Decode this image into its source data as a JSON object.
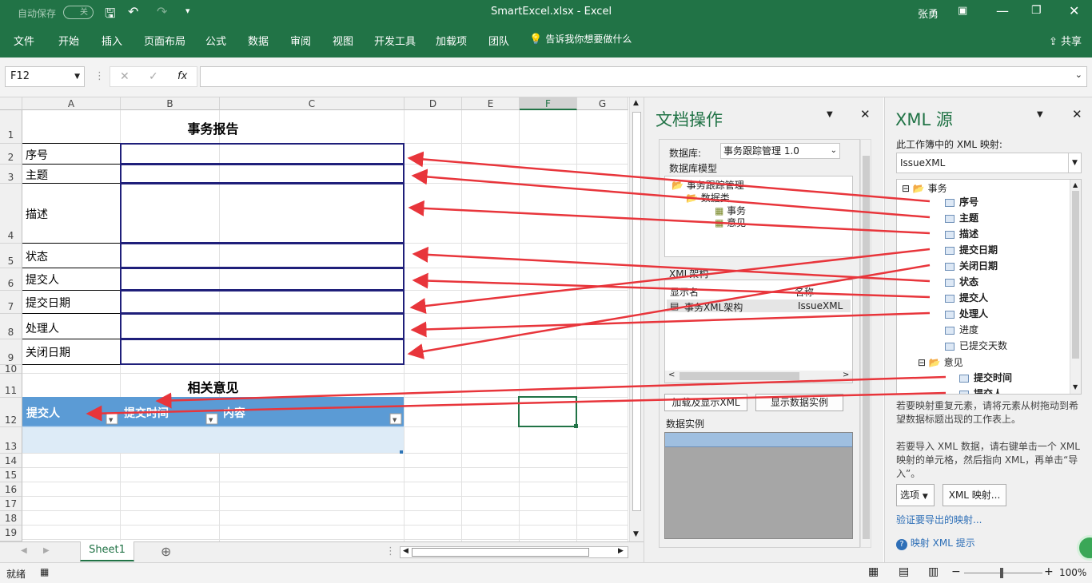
{
  "titlebar": {
    "autosave_label": "自动保存",
    "autosave_state": "关",
    "filename": "SmartExcel.xlsx  -  Excel",
    "user": "张勇"
  },
  "ribbon": {
    "tabs": [
      "文件",
      "开始",
      "插入",
      "页面布局",
      "公式",
      "数据",
      "审阅",
      "视图",
      "开发工具",
      "加载项",
      "团队"
    ],
    "tell_me": "告诉我你想要做什么",
    "share": "共享"
  },
  "formula_bar": {
    "name_box": "F12",
    "fx": "fx",
    "formula": ""
  },
  "sheet": {
    "columns": [
      "A",
      "B",
      "C",
      "D",
      "E",
      "F",
      "G"
    ],
    "rows": [
      "1",
      "2",
      "3",
      "4",
      "5",
      "6",
      "7",
      "8",
      "9",
      "10",
      "11",
      "12",
      "13",
      "14",
      "15",
      "16",
      "17",
      "18",
      "19"
    ],
    "report_title": "事务报告",
    "labels": [
      "序号",
      "主题",
      "描述",
      "状态",
      "提交人",
      "提交日期",
      "处理人",
      "关闭日期"
    ],
    "opinion_title": "相关意见",
    "table_headers": [
      "提交人",
      "提交时间",
      "内容"
    ],
    "tab": "Sheet1"
  },
  "doc_panel": {
    "title": "文档操作",
    "db_label": "数据库:",
    "db_value": "事务跟踪管理 1.0",
    "model_label": "数据库模型",
    "tree": [
      "事务跟踪管理",
      "数据类",
      "事务",
      "意见"
    ],
    "schema_label": "XML架构",
    "col_display": "显示名",
    "col_name": "名称",
    "schema_row_display": "事务XML架构",
    "schema_row_name": "IssueXML",
    "btn_load": "加载及显示XML",
    "btn_sample": "显示数据实例",
    "sample_label": "数据实例"
  },
  "xml_panel": {
    "title": "XML 源",
    "maps_label": "此工作簿中的 XML 映射:",
    "map_value": "IssueXML",
    "root": "事务",
    "nodes": [
      "序号",
      "主题",
      "描述",
      "提交日期",
      "关闭日期",
      "状态",
      "提交人",
      "处理人",
      "进度",
      "已提交天数"
    ],
    "child_group": "意见",
    "child_nodes": [
      "提交时间",
      "提交人"
    ],
    "hint1": "若要映射重复元素，请将元素从树拖动到希望数据标题出现的工作表上。",
    "hint2": "若要导入 XML 数据，请右键单击一个 XML 映射的单元格，然后指向 XML，再单击“导入”。",
    "btn_options": "选项",
    "btn_maps": "XML 映射...",
    "verify_link": "验证要导出的映射...",
    "help_link": "映射 XML 提示"
  },
  "status": {
    "ready": "就绪",
    "zoom": "100%"
  },
  "colors": {
    "excel_green": "#217346",
    "arrow_red": "#e8353b",
    "table_header_blue": "#5b9bd5",
    "table_row_blue": "#ddebf7",
    "border_navy": "#1f1f7a"
  }
}
